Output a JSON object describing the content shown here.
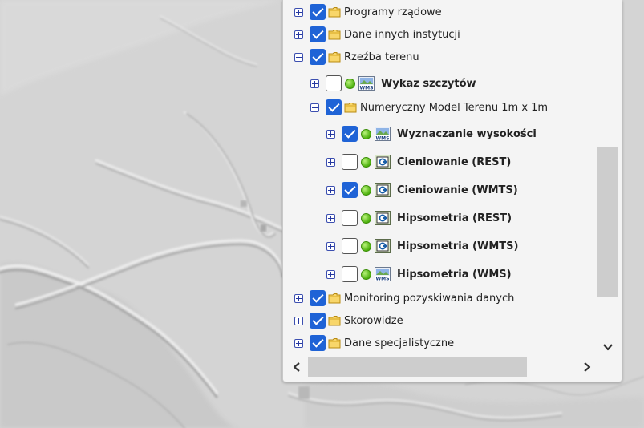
{
  "tree": {
    "groups_top": [
      {
        "label": "Programy rządowe",
        "checked": true,
        "expanded": false
      },
      {
        "label": "Dane innych instytucji",
        "checked": true,
        "expanded": false
      },
      {
        "label": "Rzeźba terenu",
        "checked": true,
        "expanded": true
      }
    ],
    "rzezba_layers": [
      {
        "label": "Wykaz szczytów",
        "checked": false,
        "service": "wms-icon"
      }
    ],
    "subgroup": {
      "label": "Numeryczny Model Terenu 1m x 1m",
      "checked": true,
      "expanded": true
    },
    "nmt_layers": [
      {
        "label": "Wyznaczanie wysokości",
        "checked": true,
        "service": "wms-icon"
      },
      {
        "label": "Cieniowanie (REST)",
        "checked": false,
        "service": "rest-service-icon"
      },
      {
        "label": "Cieniowanie (WMTS)",
        "checked": true,
        "service": "rest-service-icon"
      },
      {
        "label": "Hipsometria (REST)",
        "checked": false,
        "service": "rest-service-icon"
      },
      {
        "label": "Hipsometria (WMTS)",
        "checked": false,
        "service": "rest-service-icon"
      },
      {
        "label": "Hipsometria (WMS)",
        "checked": false,
        "service": "wms-icon"
      }
    ],
    "groups_bottom": [
      {
        "label": "Monitoring pozyskiwania danych",
        "checked": true,
        "expanded": false
      },
      {
        "label": "Skorowidze",
        "checked": true,
        "expanded": false
      },
      {
        "label": "Dane specjalistyczne",
        "checked": true,
        "expanded": false
      }
    ]
  },
  "service_icon_text": "WMS",
  "colors": {
    "checkbox": "#1f63d6",
    "expander": "#2638a0",
    "status_dot": "#4cb00c",
    "folder": "#f2c230"
  }
}
